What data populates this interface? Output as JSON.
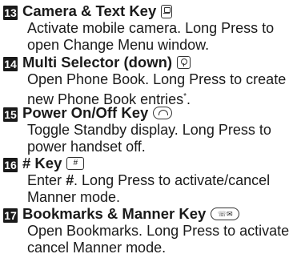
{
  "entries": [
    {
      "num": "13",
      "title": "Camera & Text Key",
      "icon": "camera-text-key-icon",
      "line1": "Activate mobile camera. Long Press to",
      "line2": "open Change Menu window."
    },
    {
      "num": "14",
      "title": "Multi Selector (down)",
      "icon": "multi-selector-down-icon",
      "line1": "Open Phone Book. Long Press to create",
      "line2": "new Phone Book entries",
      "line2_suffix": "*",
      "line2_end": "."
    },
    {
      "num": "15",
      "title": "Power On/Off Key",
      "icon": "power-key-icon",
      "line1": "Toggle Standby display. Long Press to",
      "line2": "power handset off."
    },
    {
      "num": "16",
      "title": "# Key",
      "icon": "hash-key-icon",
      "key_text": "#",
      "line1_pre": "Enter ",
      "line1_em": "#",
      "line1_post": ". Long Press to activate/cancel",
      "line2": "Manner mode."
    },
    {
      "num": "17",
      "title": "Bookmarks & Manner Key",
      "icon": "bookmarks-manner-key-icon",
      "line1": "Open Bookmarks. Long Press to activate",
      "line2": "cancel Manner mode."
    }
  ]
}
